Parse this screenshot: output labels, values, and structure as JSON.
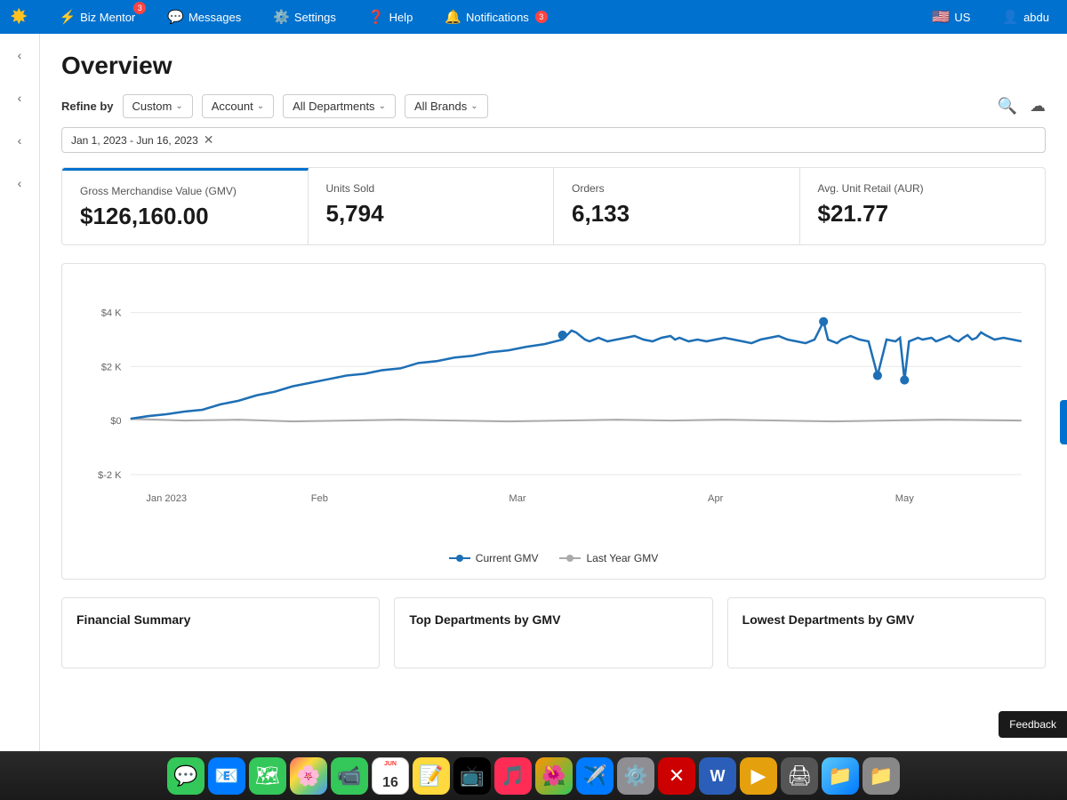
{
  "nav": {
    "logo": "✸",
    "biz_mentor": "Biz Mentor",
    "messages": "Messages",
    "settings": "Settings",
    "help": "Help",
    "notifications": "Notifications",
    "notifications_badge": "3",
    "locale": "US",
    "user": "abdu"
  },
  "page": {
    "title": "Overview",
    "refine_label": "Refine by",
    "filters": [
      {
        "label": "Custom",
        "id": "custom"
      },
      {
        "label": "Account",
        "id": "account"
      },
      {
        "label": "All Departments",
        "id": "all-departments"
      },
      {
        "label": "All Brands",
        "id": "all-brands"
      }
    ],
    "date_range": "Jan 1, 2023 - Jun 16, 2023"
  },
  "metrics": [
    {
      "label": "Gross Merchandise Value (GMV)",
      "value": "$126,160.00",
      "active": true
    },
    {
      "label": "Units Sold",
      "value": "5,794",
      "active": false
    },
    {
      "label": "Orders",
      "value": "6,133",
      "active": false
    },
    {
      "label": "Avg. Unit Retail (AUR)",
      "value": "$21.77",
      "active": false
    }
  ],
  "chart": {
    "y_labels": [
      "$4 K",
      "$2 K",
      "$0",
      "$-2 K"
    ],
    "x_labels": [
      "Jan 2023",
      "Feb",
      "Mar",
      "Apr",
      "May"
    ],
    "legend": [
      {
        "label": "Current GMV",
        "color": "#1e6fb5"
      },
      {
        "label": "Last Year GMV",
        "color": "#aaaaaa"
      }
    ]
  },
  "bottom_cards": [
    {
      "title": "Financial Summary"
    },
    {
      "title": "Top Departments by GMV"
    },
    {
      "title": "Lowest Departments by GMV"
    }
  ],
  "feedback": "Feedback",
  "dock": {
    "date_month": "JUN",
    "date_day": "16",
    "items": [
      {
        "icon": "💬",
        "color": "#34c759",
        "label": "messages"
      },
      {
        "icon": "📧",
        "color": "#007aff",
        "label": "mail"
      },
      {
        "icon": "🗺",
        "color": "#34c759",
        "label": "maps"
      },
      {
        "icon": "🖼",
        "color": "#ff9500",
        "label": "photos"
      },
      {
        "icon": "📹",
        "color": "#34c759",
        "label": "facetime"
      },
      {
        "icon": "📅",
        "color": "#ff3b30",
        "label": "calendar"
      },
      {
        "icon": "📝",
        "color": "#ff9500",
        "label": "notes"
      },
      {
        "icon": "🎬",
        "color": "#000",
        "label": "appletv"
      },
      {
        "icon": "🎵",
        "color": "#ff2d55",
        "label": "music"
      },
      {
        "icon": "🖼",
        "color": "#007aff",
        "label": "photos2"
      },
      {
        "icon": "📲",
        "color": "#007aff",
        "label": "testflight"
      },
      {
        "icon": "⚙️",
        "color": "#8e8e93",
        "label": "settings"
      },
      {
        "icon": "❌",
        "color": "#ff3b30",
        "label": "rdp"
      },
      {
        "icon": "W",
        "color": "#2b5eb8",
        "label": "word"
      },
      {
        "icon": "▶",
        "color": "#ff6b35",
        "label": "plex"
      },
      {
        "icon": "🖨",
        "color": "#555",
        "label": "printer"
      },
      {
        "icon": "📁",
        "color": "#007aff",
        "label": "files"
      },
      {
        "icon": "📁",
        "color": "#888",
        "label": "files2"
      }
    ]
  }
}
